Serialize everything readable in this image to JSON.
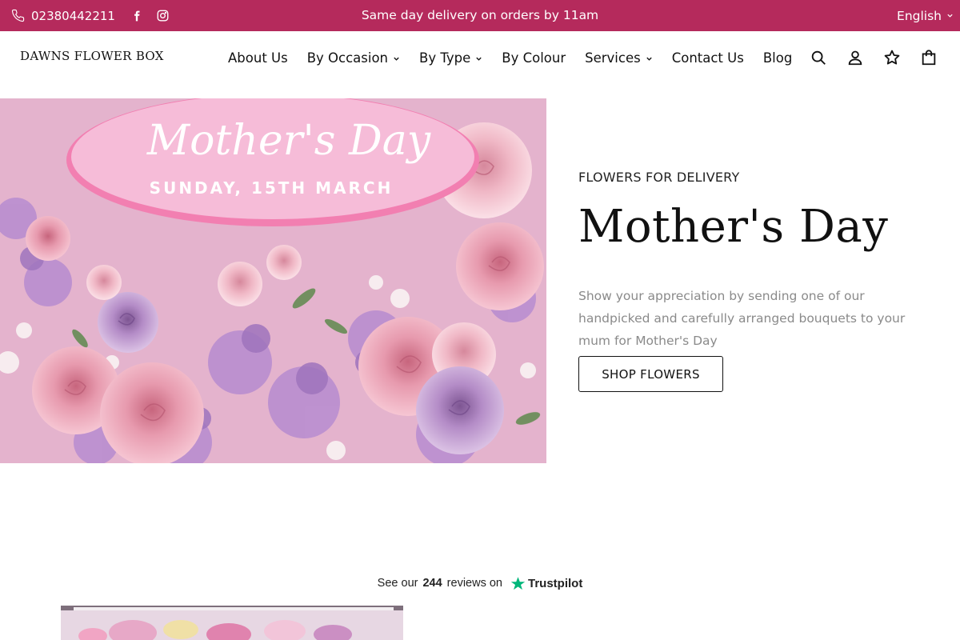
{
  "topbar": {
    "phone": "02380442211",
    "promo": "Same day delivery on orders by 11am",
    "language": "English",
    "background": "#b52a5c"
  },
  "header": {
    "logo": "DAWNS FLOWER BOX",
    "nav": [
      {
        "label": "About Us",
        "dropdown": false
      },
      {
        "label": "By Occasion",
        "dropdown": true
      },
      {
        "label": "By Type",
        "dropdown": true
      },
      {
        "label": "By Colour",
        "dropdown": false
      },
      {
        "label": "Services",
        "dropdown": true
      },
      {
        "label": "Contact Us",
        "dropdown": false
      },
      {
        "label": "Blog",
        "dropdown": false
      }
    ],
    "icons": [
      "search-icon",
      "account-icon",
      "wishlist-star-icon",
      "cart-bag-icon"
    ]
  },
  "hero": {
    "image": {
      "banner_title": "Mother's Day",
      "banner_date": "SUNDAY, 15TH MARCH"
    },
    "eyebrow": "FLOWERS FOR DELIVERY",
    "title": "Mother's Day",
    "description": "Show your appreciation by sending one of our handpicked and carefully arranged bouquets to your mum for Mother's Day",
    "button": "SHOP FLOWERS"
  },
  "trustpilot": {
    "prefix": "See our",
    "count": "244",
    "suffix": "reviews on",
    "brand": "Trustpilot",
    "star_color": "#00b67a"
  }
}
